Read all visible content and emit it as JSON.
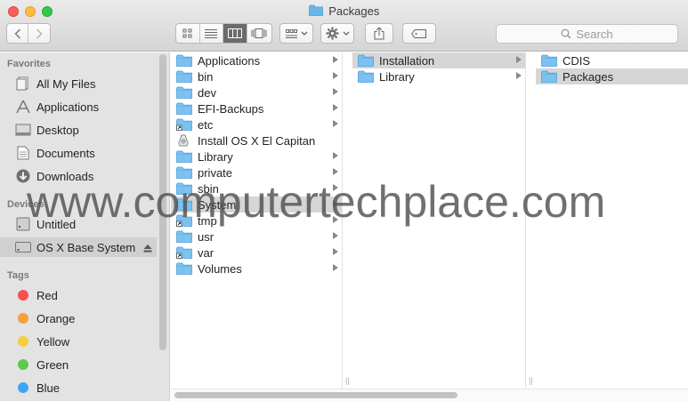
{
  "window": {
    "title": "Packages"
  },
  "toolbar": {
    "back_icon": "chevron-left-icon",
    "forward_icon": "chevron-right-icon",
    "view_modes": [
      "icon-view-icon",
      "list-view-icon",
      "column-view-icon",
      "cover-flow-icon"
    ],
    "active_view": "column-view-icon",
    "arrange_icon": "arrange-icon",
    "action_icon": "gear-icon",
    "share_icon": "share-icon",
    "tag_icon": "tag-icon",
    "search_placeholder": "Search"
  },
  "sidebar": {
    "favorites_heading": "Favorites",
    "favorites": [
      {
        "label": "All My Files",
        "icon": "all-files-icon"
      },
      {
        "label": "Applications",
        "icon": "applications-icon"
      },
      {
        "label": "Desktop",
        "icon": "desktop-icon"
      },
      {
        "label": "Documents",
        "icon": "documents-icon"
      },
      {
        "label": "Downloads",
        "icon": "downloads-icon"
      }
    ],
    "devices_heading": "Devices",
    "devices": [
      {
        "label": "Untitled",
        "icon": "disk-icon"
      },
      {
        "label": "OS X Base System",
        "icon": "disk-icon",
        "selected": true
      }
    ],
    "tags_heading": "Tags",
    "tags": [
      {
        "label": "Red",
        "color": "#f5504f"
      },
      {
        "label": "Orange",
        "color": "#f6a03e"
      },
      {
        "label": "Yellow",
        "color": "#f5cd3e"
      },
      {
        "label": "Green",
        "color": "#5dc94f"
      },
      {
        "label": "Blue",
        "color": "#3ea5f4"
      }
    ]
  },
  "columns": [
    {
      "items": [
        {
          "label": "Applications",
          "icon": "folder-icon",
          "arrow": true
        },
        {
          "label": "bin",
          "icon": "folder-icon",
          "arrow": true
        },
        {
          "label": "dev",
          "icon": "folder-icon",
          "arrow": true
        },
        {
          "label": "EFI-Backups",
          "icon": "folder-icon",
          "arrow": true
        },
        {
          "label": "etc",
          "icon": "alias-folder-icon",
          "arrow": true
        },
        {
          "label": "Install OS X El Capitan",
          "icon": "installer-icon",
          "arrow": false
        },
        {
          "label": "Library",
          "icon": "folder-icon",
          "arrow": true
        },
        {
          "label": "private",
          "icon": "folder-icon",
          "arrow": true
        },
        {
          "label": "sbin",
          "icon": "folder-icon",
          "arrow": true
        },
        {
          "label": "System",
          "icon": "folder-icon",
          "arrow": true,
          "selected": true
        },
        {
          "label": "tmp",
          "icon": "alias-folder-icon",
          "arrow": true
        },
        {
          "label": "usr",
          "icon": "folder-icon",
          "arrow": true
        },
        {
          "label": "var",
          "icon": "alias-folder-icon",
          "arrow": true
        },
        {
          "label": "Volumes",
          "icon": "folder-icon",
          "arrow": true
        }
      ]
    },
    {
      "items": [
        {
          "label": "Installation",
          "icon": "folder-icon",
          "arrow": true,
          "selected": true
        },
        {
          "label": "Library",
          "icon": "folder-icon",
          "arrow": true
        }
      ]
    },
    {
      "items": [
        {
          "label": "CDIS",
          "icon": "folder-icon",
          "arrow": false
        },
        {
          "label": "Packages",
          "icon": "folder-icon",
          "arrow": false,
          "selected": true
        }
      ]
    }
  ],
  "watermark": "www.computertechplace.com"
}
